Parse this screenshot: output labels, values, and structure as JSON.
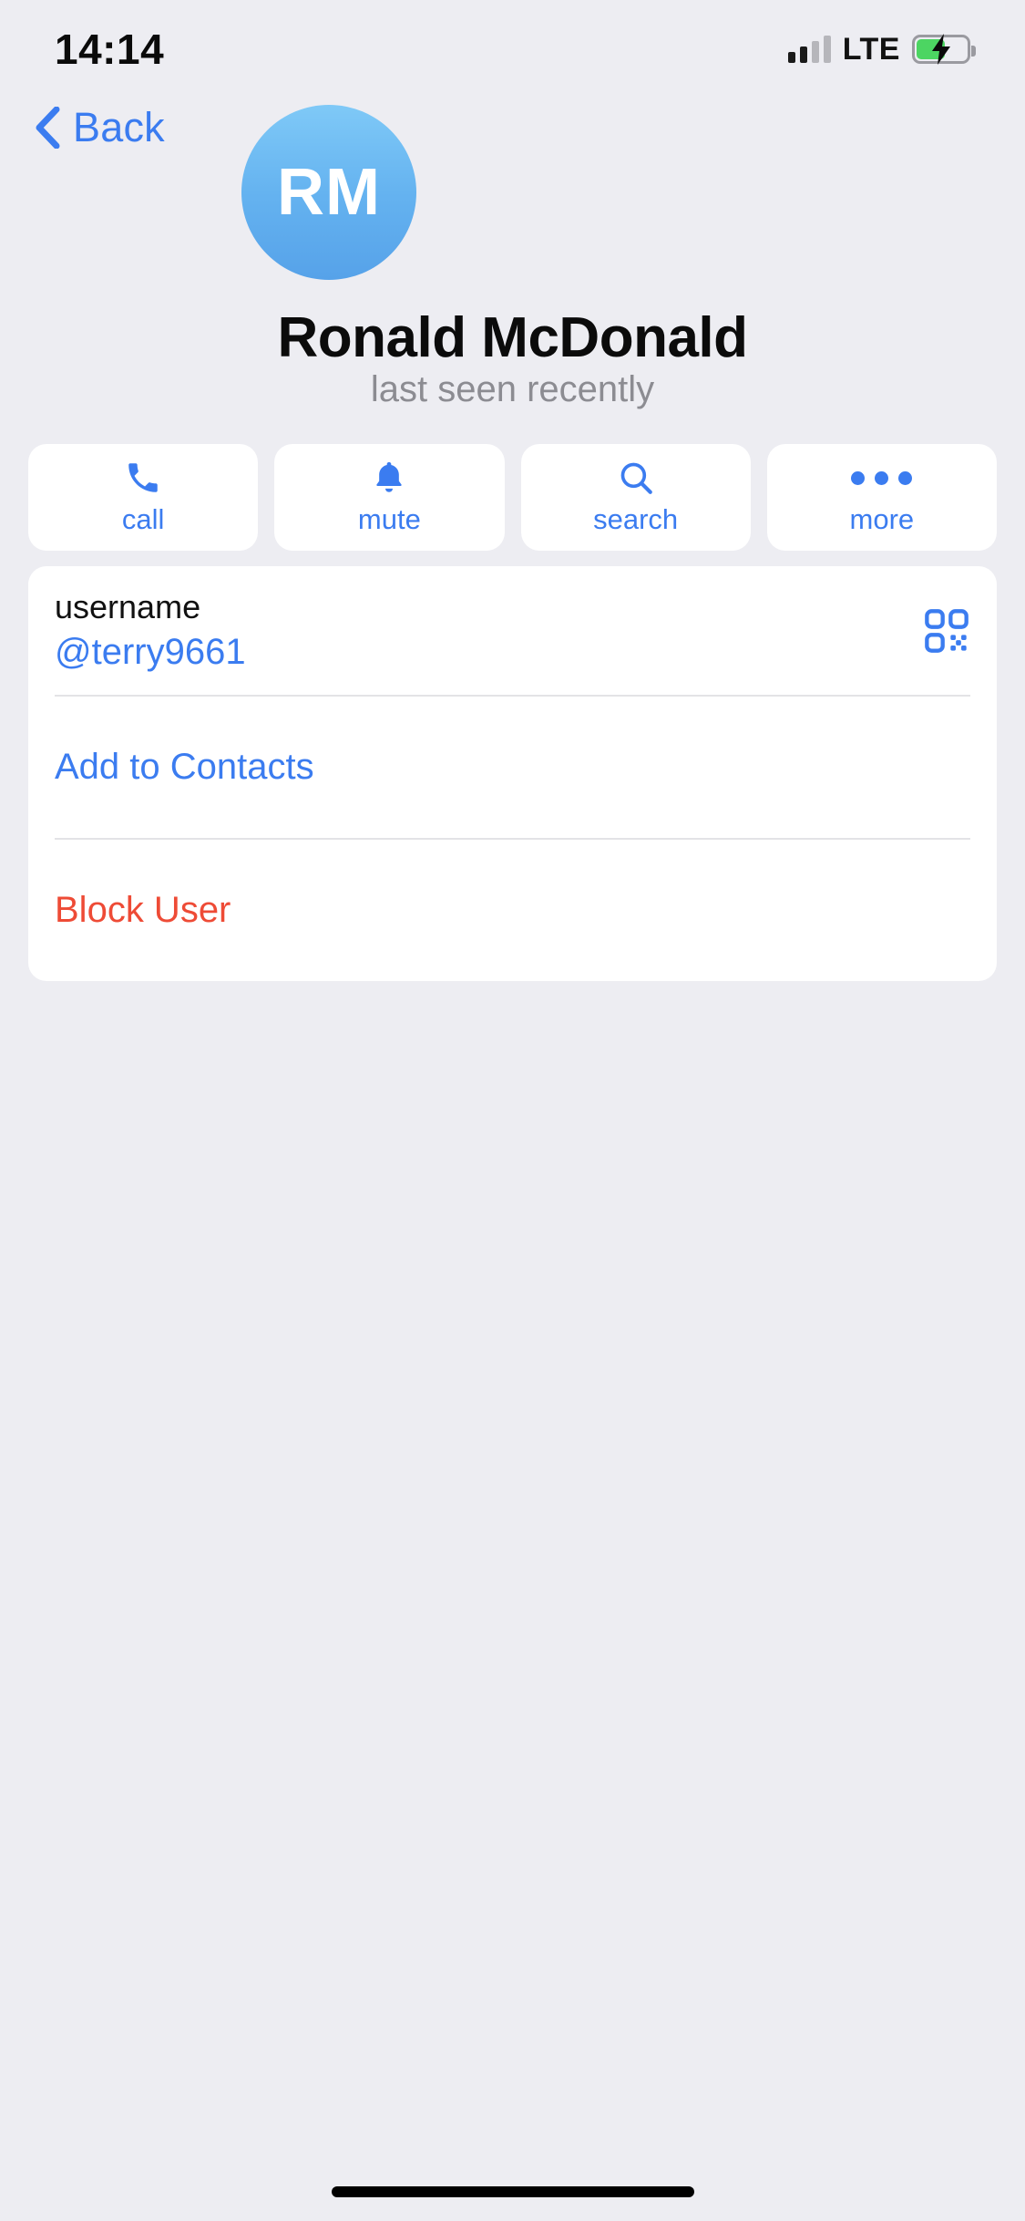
{
  "status_bar": {
    "time": "14:14",
    "network_label": "LTE",
    "signal_bars_filled": 2,
    "signal_bars_total": 4,
    "battery_percent": 57,
    "battery_charging": true,
    "battery_color": "#4CD562"
  },
  "nav": {
    "back_label": "Back",
    "back_icon": "chevron-left-icon"
  },
  "profile": {
    "initials": "RM",
    "name": "Ronald McDonald",
    "status": "last seen recently",
    "avatar_gradient_top": "#7FC9F7",
    "avatar_gradient_bottom": "#56A2E9"
  },
  "actions": [
    {
      "label": "call",
      "icon": "phone-icon"
    },
    {
      "label": "mute",
      "icon": "bell-icon"
    },
    {
      "label": "search",
      "icon": "search-icon"
    },
    {
      "label": "more",
      "icon": "ellipsis-icon"
    }
  ],
  "info_card": {
    "username_label": "username",
    "username_value": "@terry9661",
    "qr_icon": "qr-code-icon",
    "add_to_contacts_label": "Add to Contacts",
    "block_user_label": "Block User"
  },
  "colors": {
    "accent_blue": "#3B7CF0",
    "danger_red": "#EE4B36",
    "background": "#EDEDF2",
    "card": "#FFFFFF",
    "secondary_text": "#8C8C92"
  }
}
